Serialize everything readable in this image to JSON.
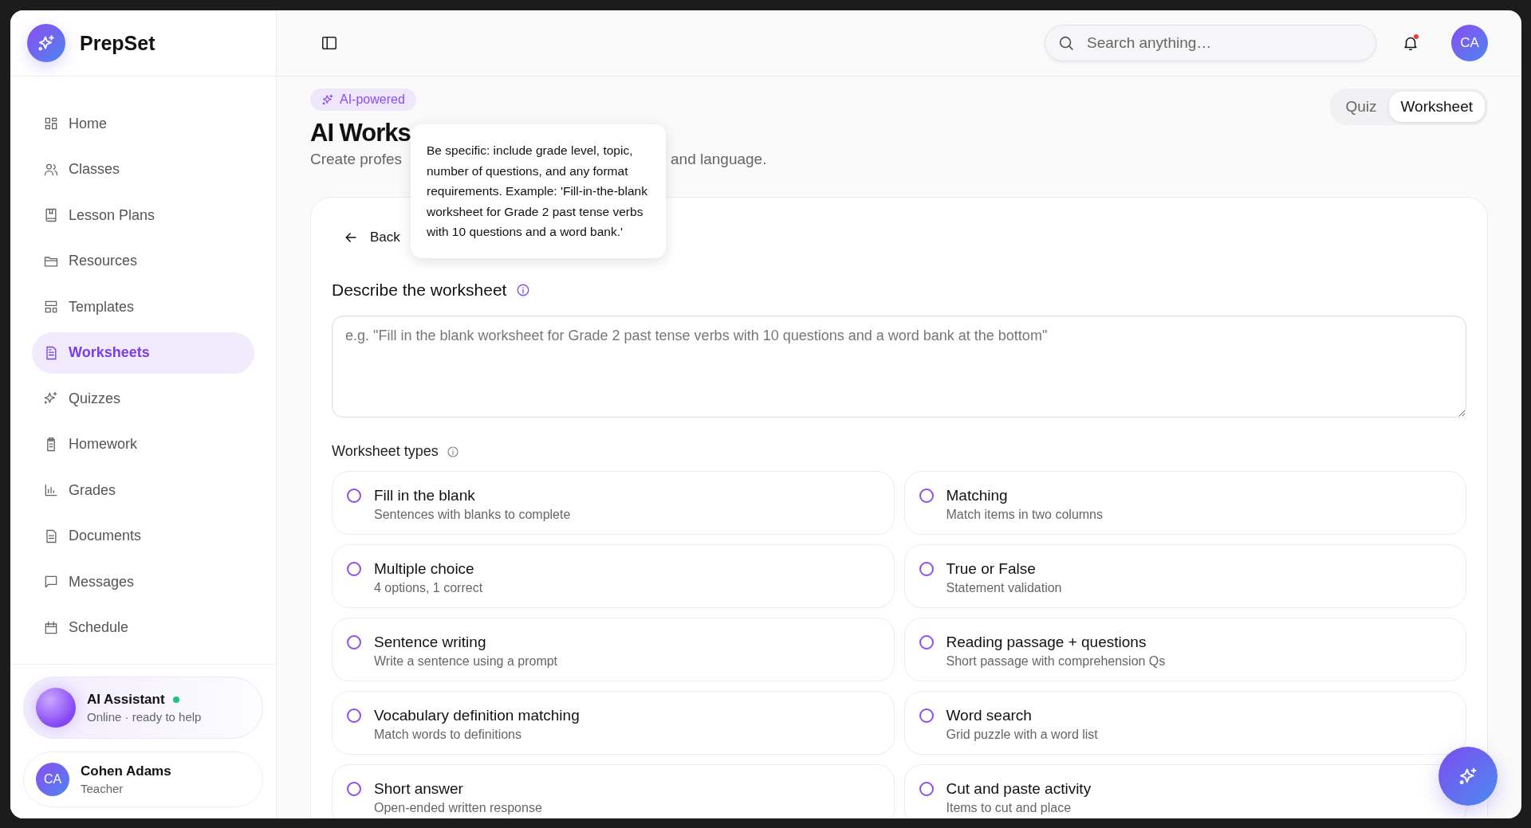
{
  "app": {
    "name": "PrepSet"
  },
  "sidebar": {
    "items": [
      {
        "label": "Home",
        "selected": false
      },
      {
        "label": "Classes",
        "selected": false
      },
      {
        "label": "Lesson Plans",
        "selected": false
      },
      {
        "label": "Resources",
        "selected": false
      },
      {
        "label": "Templates",
        "selected": false
      },
      {
        "label": "Worksheets",
        "selected": true
      },
      {
        "label": "Quizzes",
        "selected": false
      },
      {
        "label": "Homework",
        "selected": false
      },
      {
        "label": "Grades",
        "selected": false
      },
      {
        "label": "Documents",
        "selected": false
      },
      {
        "label": "Messages",
        "selected": false
      },
      {
        "label": "Schedule",
        "selected": false
      }
    ]
  },
  "assistant": {
    "name": "AI Assistant",
    "online": true,
    "status": "Online · ready to help"
  },
  "user": {
    "initials": "CA",
    "name": "Cohen Adams",
    "role": "Teacher"
  },
  "header": {
    "search": {
      "placeholder": "Search anything…"
    },
    "notifications": {
      "unread": true
    },
    "avatar": "CA"
  },
  "badge": "AI-powered",
  "mode_tabs": [
    {
      "label": "Quiz",
      "selected": false
    },
    {
      "label": "Worksheet",
      "selected": true
    }
  ],
  "title": "AI Works",
  "subtitle_parts": [
    "Create profes",
    "and language."
  ],
  "tooltip": "Be specific: include grade level, topic, number of questions, and any format requirements. Example: 'Fill-in-the-blank worksheet for Grade 2 past tense verbs with 10 questions and a word bank.'",
  "back": "Back",
  "prompt": {
    "label": "Describe the worksheet",
    "placeholder": "e.g. \"Fill in the blank worksheet for Grade 2 past tense verbs with 10 questions and a word bank at the bottom\""
  },
  "types": {
    "label": "Worksheet types",
    "options": [
      {
        "title": "Fill in the blank",
        "description": "Sentences with blanks to complete",
        "selected": false
      },
      {
        "title": "Matching",
        "description": "Match items in two columns",
        "selected": false
      },
      {
        "title": "Multiple choice",
        "description": "4 options, 1 correct",
        "selected": false
      },
      {
        "title": "True or False",
        "description": "Statement validation",
        "selected": false
      },
      {
        "title": "Sentence writing",
        "description": "Write a sentence using a prompt",
        "selected": false
      },
      {
        "title": "Reading passage + questions",
        "description": "Short passage with comprehension Qs",
        "selected": false
      },
      {
        "title": "Vocabulary definition matching",
        "description": "Match words to definitions",
        "selected": false
      },
      {
        "title": "Word search",
        "description": "Grid puzzle with a word list",
        "selected": false
      },
      {
        "title": "Short answer",
        "description": "Open-ended written response",
        "selected": false
      },
      {
        "title": "Cut and paste activity",
        "description": "Items to cut and place",
        "selected": false
      }
    ]
  }
}
